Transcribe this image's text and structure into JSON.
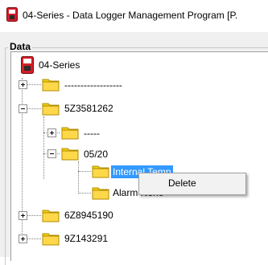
{
  "window": {
    "title": "04-Series - Data Logger Management Program [P."
  },
  "panel": {
    "label": "Data"
  },
  "tree": {
    "root": "04-Series",
    "nodes": {
      "n1": "------------------",
      "n2": "5Z3581262",
      "n2a": "-----",
      "n2b": "05/20",
      "n2b1": "Internal Temp",
      "n2b2": "Alarm None",
      "n3": "6Z8945190",
      "n4": "9Z143291"
    }
  },
  "context_menu": {
    "items": [
      "Delete"
    ]
  },
  "colors": {
    "selection": "#3399ff",
    "folder": "#f5d000",
    "logger_icon": "#d21e28"
  }
}
